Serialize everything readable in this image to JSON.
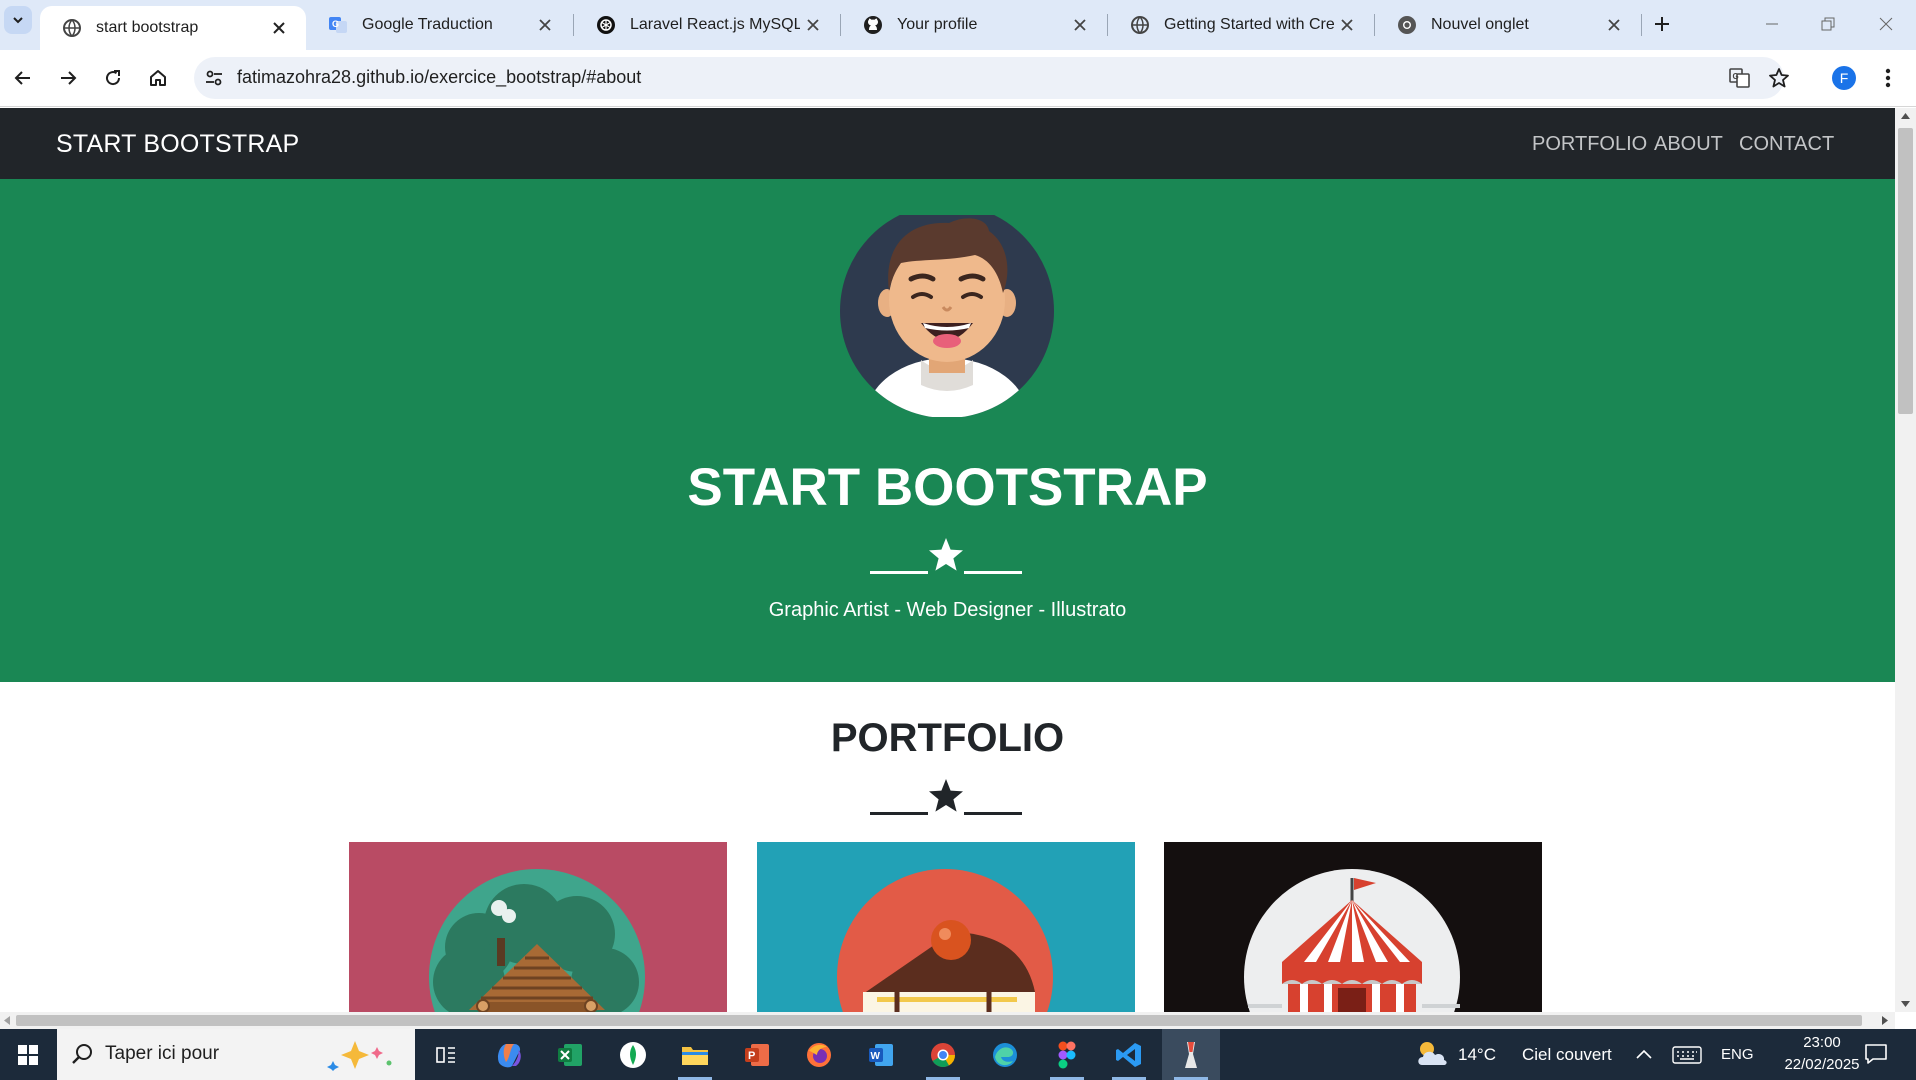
{
  "browser": {
    "tabs": [
      {
        "title": "start bootstrap",
        "icon": "globe-icon",
        "active": true
      },
      {
        "title": "Google Traduction",
        "icon": "google-translate-icon",
        "active": false
      },
      {
        "title": "Laravel React.js MySQL Sta",
        "icon": "openai-icon",
        "active": false
      },
      {
        "title": "Your profile",
        "icon": "github-icon",
        "active": false
      },
      {
        "title": "Getting Started with Create",
        "icon": "globe-icon",
        "active": false
      },
      {
        "title": "Nouvel onglet",
        "icon": "chrome-icon",
        "active": false
      }
    ],
    "url": "fatimazohra28.github.io/exercice_bootstrap/#about",
    "profile_initial": "F"
  },
  "site": {
    "brand": "START BOOTSTRAP",
    "nav": [
      "PORTFOLIO",
      "ABOUT",
      "CONTACT"
    ],
    "hero": {
      "title": "START BOOTSTRAP",
      "subtitle": "Graphic Artist - Web Designer - Illustrato"
    },
    "portfolio": {
      "title": "PORTFOLIO",
      "cards": [
        {
          "name": "cabin",
          "bg": "#b94b64"
        },
        {
          "name": "cake",
          "bg": "#22a1b6"
        },
        {
          "name": "circus",
          "bg": "#140f0f"
        }
      ]
    },
    "colors": {
      "navbar": "#212529",
      "hero": "#1a8754",
      "text_dark": "#212529"
    }
  },
  "taskbar": {
    "search_placeholder": "Taper ici pour",
    "apps": [
      "task-view-icon",
      "copilot-icon",
      "excel-icon",
      "mongodb-compass-icon",
      "file-explorer-icon",
      "powerpoint-icon",
      "firefox-icon",
      "word-icon",
      "chrome-icon",
      "edge-icon",
      "figma-icon",
      "vscode-icon",
      "git-icon"
    ],
    "weather": {
      "temp": "14°C",
      "desc": "Ciel couvert"
    },
    "language": "ENG",
    "time": "23:00",
    "date": "22/02/2025"
  }
}
